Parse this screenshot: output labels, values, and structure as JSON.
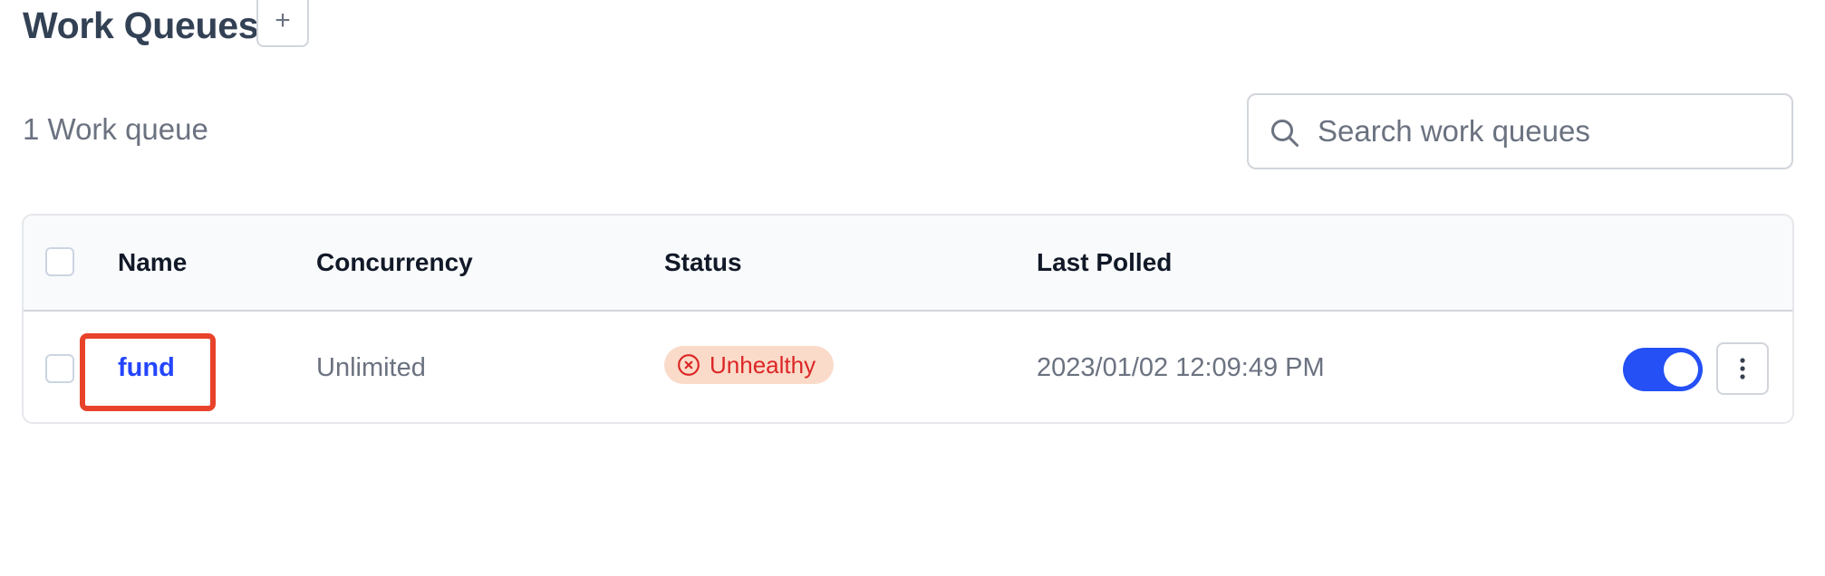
{
  "header": {
    "title": "Work Queues",
    "add_label": "+"
  },
  "summary": {
    "count_label": "1 Work queue"
  },
  "search": {
    "placeholder": "Search work queues",
    "value": ""
  },
  "table": {
    "columns": [
      "Name",
      "Concurrency",
      "Status",
      "Last Polled"
    ],
    "rows": [
      {
        "name": "fund",
        "concurrency": "Unlimited",
        "status": "Unhealthy",
        "last_polled": "2023/01/02 12:09:49 PM",
        "enabled": true
      }
    ]
  },
  "colors": {
    "accent": "#2450f5",
    "link": "#2445ff",
    "status_unhealthy_text": "#dc2626",
    "status_unhealthy_bg": "#fadbc9",
    "highlight": "#e8432a"
  },
  "icons": {
    "search": "search-icon",
    "status": "x-circle-icon",
    "menu": "kebab-menu-icon"
  }
}
